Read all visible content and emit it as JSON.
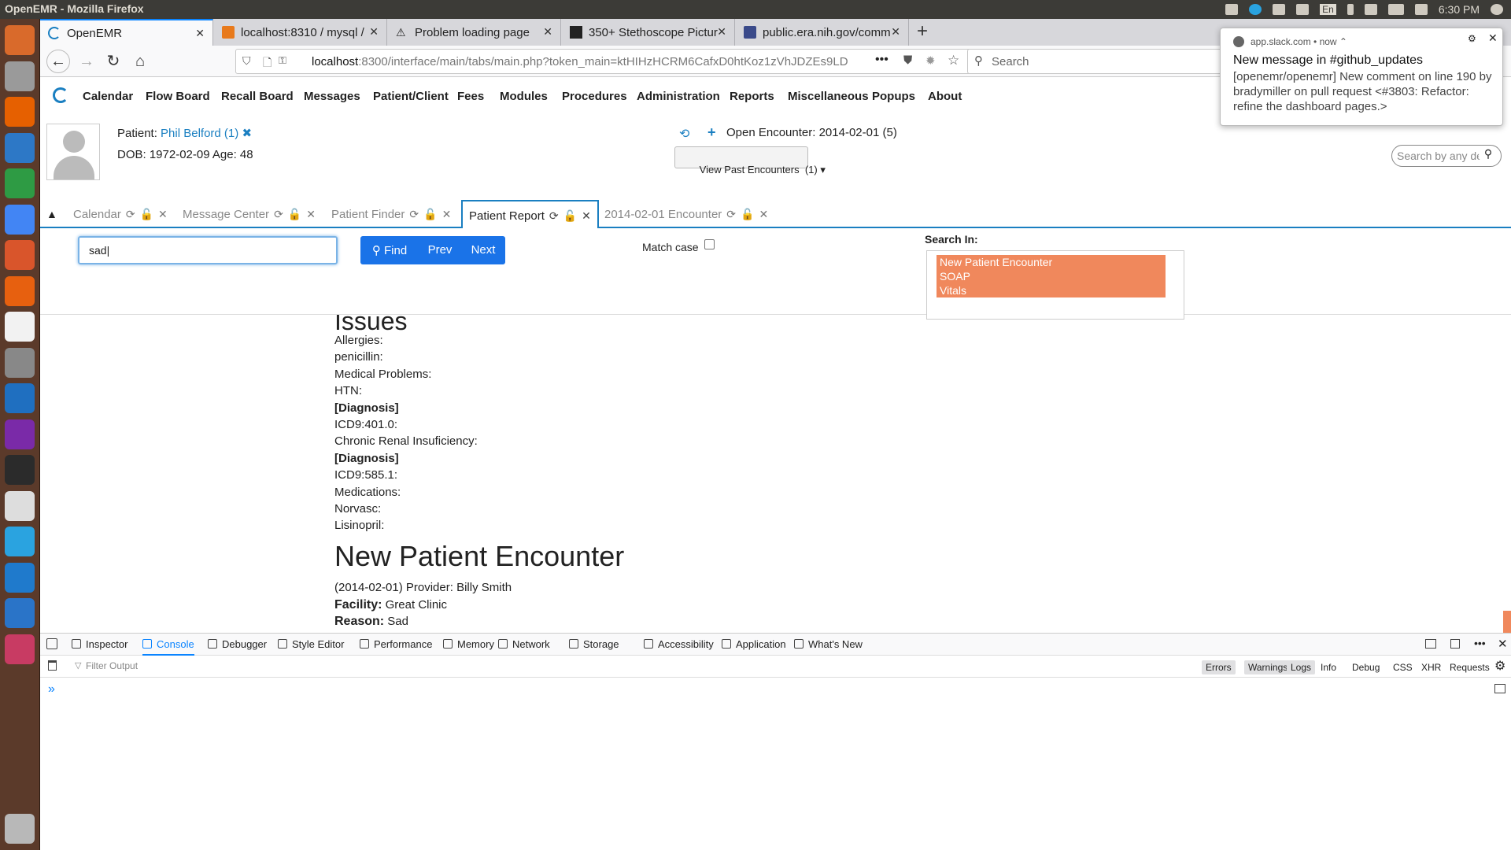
{
  "window_title": "OpenEMR - Mozilla Firefox",
  "clock": "6:30 PM",
  "keyboard_layout": "En",
  "launcher_icons": [
    "ubuntu-dash-icon",
    "files-icon",
    "firefox-icon",
    "writer-icon",
    "calc-icon",
    "chrome-icon",
    "impress-icon",
    "software-center-icon",
    "amazon-icon",
    "settings-icon",
    "thunderbird-icon",
    "phpstorm-icon",
    "terminal-icon",
    "text-editor-icon",
    "telegram-icon",
    "vscode-icon",
    "system-monitor-icon",
    "media-icon",
    "trash-icon"
  ],
  "browser_tabs": [
    {
      "label": "OpenEMR"
    },
    {
      "label": "localhost:8310 / mysql /"
    },
    {
      "label": "Problem loading page"
    },
    {
      "label": "350+ Stethoscope Pictur"
    },
    {
      "label": "public.era.nih.gov/comm"
    }
  ],
  "url": {
    "host": "localhost",
    "rest": ":8300/interface/main/tabs/main.php?token_main=ktHIHzHCRM6CafxD0htKoz1zVhJDZEs9LD"
  },
  "search_placeholder": "Search",
  "notification": {
    "source": "app.slack.com • now ⌃",
    "title": "New message in #github_updates",
    "body": "[openemr/openemr] New comment on line 190 by bradymiller on pull request <#3803: Refactor: refine the dashboard pages.>"
  },
  "menu": [
    "Calendar",
    "Flow Board",
    "Recall Board",
    "Messages",
    "Patient/Client",
    "Fees",
    "Modules",
    "Procedures",
    "Administration",
    "Reports",
    "Miscellaneous",
    "Popups",
    "About"
  ],
  "patient": {
    "label": "Patient:",
    "name": "Phil Belford (1)",
    "dob": "DOB: 1972-02-09 Age: 48",
    "encounter_label": "Open Encounter:",
    "encounter_value": "2014-02-01 (5)",
    "past_encounters": "View Past Encounters  (1)",
    "search_placeholder": "Search by any de"
  },
  "app_tabs": [
    {
      "label": "Calendar"
    },
    {
      "label": "Message Center"
    },
    {
      "label": "Patient Finder"
    },
    {
      "label": "Patient Report"
    },
    {
      "label": "2014-02-01 Encounter"
    }
  ],
  "find": {
    "input_value": "sad",
    "find_label": "Find",
    "prev_label": "Prev",
    "next_label": "Next",
    "match_case_label": "Match case",
    "search_in_label": "Search In:",
    "search_in_options": [
      "New Patient Encounter",
      "SOAP",
      "Vitals"
    ]
  },
  "report": {
    "issues_heading": "Issues",
    "lines": [
      {
        "text": "Allergies:",
        "bold": false
      },
      {
        "text": "penicillin:",
        "bold": false
      },
      {
        "text": "Medical Problems:",
        "bold": false
      },
      {
        "text": "HTN:",
        "bold": false
      },
      {
        "text": "[Diagnosis]",
        "bold": true
      },
      {
        "text": "ICD9:401.0:",
        "bold": false
      },
      {
        "text": "Chronic Renal Insuficiency:",
        "bold": false
      },
      {
        "text": "[Diagnosis]",
        "bold": true
      },
      {
        "text": "ICD9:585.1:",
        "bold": false
      },
      {
        "text": "Medications:",
        "bold": false
      },
      {
        "text": "Norvasc:",
        "bold": false
      },
      {
        "text": "Lisinopril:",
        "bold": false
      }
    ],
    "encounter_heading": "New Patient Encounter",
    "provider_line": "(2014-02-01) Provider: Billy Smith",
    "facility_label": "Facility:",
    "facility_value": "Great Clinic",
    "reason_label": "Reason:",
    "reason_value": "Sad"
  },
  "devtools": {
    "tabs": [
      "Inspector",
      "Console",
      "Debugger",
      "Style Editor",
      "Performance",
      "Memory",
      "Network",
      "Storage",
      "Accessibility",
      "Application",
      "What's New"
    ],
    "filter_placeholder": "Filter Output",
    "levels": [
      "Errors",
      "Warnings",
      "Logs",
      "Info",
      "Debug",
      "CSS",
      "XHR",
      "Requests"
    ],
    "prompt": "»"
  },
  "colors": {
    "accent": "#1a7fc1",
    "find_button": "#1a73e8",
    "search_in_highlight": "#f0885c",
    "launcher_bg": "#5b3a2a"
  }
}
